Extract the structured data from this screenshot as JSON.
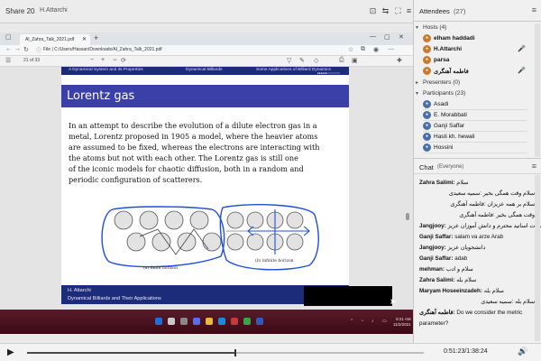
{
  "header": {
    "title": "Share 20",
    "presenter": "H.Attarchi"
  },
  "browser": {
    "tab_title": "Al_Zahra_Talk_2021.pdf",
    "url": "C:/Users/Hassan/Downloads/Al_Zahra_Talk_2021.pdf",
    "file_label": "File",
    "page_current": "21",
    "page_total": "of 33"
  },
  "slide": {
    "nav_sections": [
      "A Dynamical System and its Properties",
      "Dynamical Billiards",
      "Some Applications of Billiard Dynamics"
    ],
    "nav_dots": "●●●●●●○○○○○○○○",
    "title": "Lorentz gas",
    "body_lines": [
      "In an attempt to describe the evolution of a dilute electron gas in a",
      "metal, Lorentz proposed in 1905 a model, where the heavier atoms",
      "are assumed to be fixed, whereas the electrons are interacting with",
      "the atoms but not with each other.  The Lorentz gas is still one",
      "of the iconic models for chaotic diffusion, both in a random and",
      "periodic configuration of scatterers."
    ],
    "fig_caption_a": "(a) finite horizon",
    "fig_caption_b": "(b) infinite horizon",
    "footer_author": "H. Attarchi",
    "footer_deck": "Dynamical Billiards and Their Applications",
    "fill_progress": 0.4
  },
  "taskbar": {
    "time": "8:21 AM",
    "date": "11/2/2021"
  },
  "attendees": {
    "title": "Attendees",
    "count": "(27)",
    "hosts_label": "Hosts (4)",
    "hosts": [
      {
        "name": "elham haddadi",
        "mic": ""
      },
      {
        "name": "H.Attarchi",
        "mic": "🎤"
      },
      {
        "name": "parsa",
        "mic": ""
      },
      {
        "name": "فاطمه آهنگری",
        "mic": "🎤"
      }
    ],
    "presenters_label": "Presenters (0)",
    "participants_label": "Participants (23)",
    "participants": [
      "Asadi",
      "E. Morabbati",
      "Ganji Saffar",
      "Hasti kh. hewali",
      "Hossini"
    ]
  },
  "chat": {
    "title": "Chat",
    "scope": "(Everyone)",
    "messages": [
      {
        "sender": "Zahra Salimi:",
        "text": "سلام",
        "rtl": false
      },
      {
        "sender": "",
        "text": "سلام وقت همگی بخیر :سمیه سعیدی",
        "rtl": true
      },
      {
        "sender": "",
        "text": "سلام بر همه عزیزان :فاطمه آهنگری",
        "rtl": true
      },
      {
        "sender": "",
        "text": "وقت همگی بخیر :فاطمه آهنگری",
        "rtl": true
      },
      {
        "sender": "Jangjooy:",
        "text": "سلام خدمت اساتید محترم و دانش آموزان عزیز",
        "rtl": false
      },
      {
        "sender": "Ganji Saffar:",
        "text": "salam va arze Arab",
        "rtl": false
      },
      {
        "sender": "Jangjooy:",
        "text": "دانشجویان عزیز",
        "rtl": false
      },
      {
        "sender": "Ganji Saffar:",
        "text": "adab",
        "rtl": false
      },
      {
        "sender": "mehman:",
        "text": "سلام و ادب",
        "rtl": false
      },
      {
        "sender": "Zahra Salimi:",
        "text": "سلام بله",
        "rtl": false
      },
      {
        "sender": "Maryam Hoseeinzadeh:",
        "text": "سلام بله",
        "rtl": false
      },
      {
        "sender": "",
        "text": "سلام بله :سمیه سعیدی",
        "rtl": true
      },
      {
        "sender": "فاطمه آهنگری:",
        "text": "Do we consider the metric",
        "rtl": false
      },
      {
        "sender": "",
        "text": "parameter?",
        "rtl": false
      }
    ]
  },
  "playback": {
    "time": "0:51:23/1:38:24",
    "progress": 0.523
  }
}
